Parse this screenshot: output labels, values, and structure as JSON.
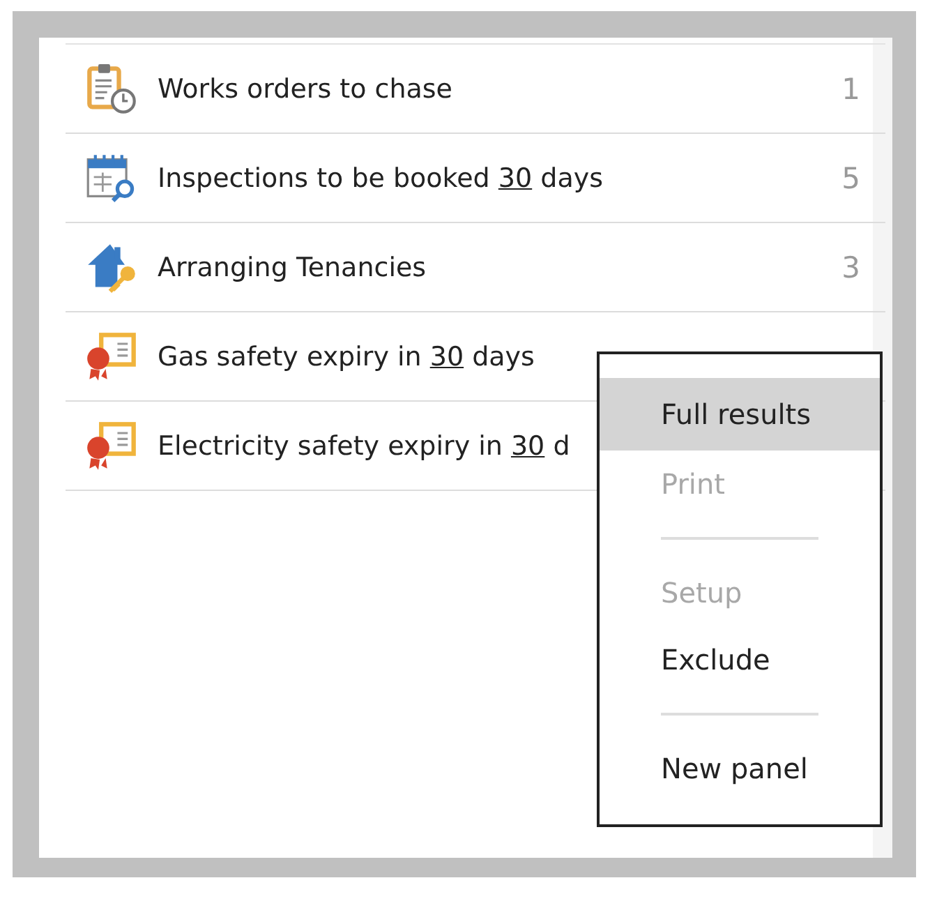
{
  "rows": [
    {
      "kind": "clipboard",
      "text": "Works orders to chase",
      "count": "1"
    },
    {
      "kind": "calendar",
      "text": "Inspections to be booked ",
      "link": "30",
      "suffix": " days",
      "count": "5"
    },
    {
      "kind": "house",
      "text": "Arranging Tenancies",
      "count": "3"
    },
    {
      "kind": "certificate",
      "text": "Gas safety expiry in ",
      "link": "30",
      "suffix": " days"
    },
    {
      "kind": "certificate",
      "text": "Electricity safety expiry in ",
      "link": "30",
      "suffix": " d"
    }
  ],
  "context_menu": [
    {
      "kind": "item",
      "label": "Full results",
      "selected": true,
      "disabled": false
    },
    {
      "kind": "item",
      "label": "Print",
      "selected": false,
      "disabled": true
    },
    {
      "kind": "separator"
    },
    {
      "kind": "item",
      "label": "Setup",
      "selected": false,
      "disabled": true
    },
    {
      "kind": "item",
      "label": "Exclude",
      "selected": false,
      "disabled": false
    },
    {
      "kind": "separator"
    },
    {
      "kind": "item",
      "label": "New panel",
      "selected": false,
      "disabled": false
    }
  ]
}
